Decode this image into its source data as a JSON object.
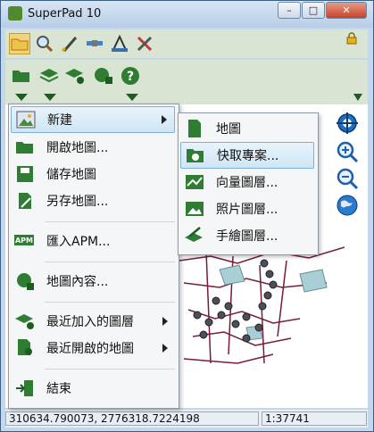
{
  "window": {
    "title": "SuperPad 10"
  },
  "window_buttons": {
    "minimize": "–",
    "maximize": "□",
    "close": "✕"
  },
  "toolbar1": {
    "items": [
      "folder-icon",
      "magnifier-icon",
      "pencil-icon",
      "satellite-icon",
      "survey-icon",
      "tools-icon"
    ],
    "selected": "folder-icon"
  },
  "toolbar2": {
    "items": [
      "open-folder-dropdown",
      "layers-add-dropdown",
      "layers-settings-dropdown",
      "globe-lock-dropdown",
      "help-dropdown"
    ]
  },
  "main_menu": {
    "items": [
      {
        "label": "新建",
        "icon": "new-image-icon",
        "submenu": true,
        "highlighted": true
      },
      {
        "label": "開啟地圖...",
        "icon": "open-folder-icon"
      },
      {
        "label": "儲存地圖",
        "icon": "save-icon"
      },
      {
        "label": "另存地圖...",
        "icon": "save-as-icon"
      },
      {
        "label": "匯入APM...",
        "icon": "apm-import-icon"
      },
      {
        "label": "地圖內容...",
        "icon": "map-properties-icon"
      },
      {
        "label": "最近加入的圖層",
        "icon": "recent-layers-icon",
        "submenu": true
      },
      {
        "label": "最近開啟的地圖",
        "icon": "recent-maps-icon",
        "submenu": true
      },
      {
        "label": "結束",
        "icon": "exit-icon"
      }
    ]
  },
  "submenu": {
    "items": [
      {
        "label": "地圖",
        "icon": "map-document-icon"
      },
      {
        "label": "快取專案...",
        "icon": "cache-project-icon",
        "highlighted": true
      },
      {
        "label": "向量圖層...",
        "icon": "vector-layer-icon"
      },
      {
        "label": "照片圖層...",
        "icon": "photo-layer-icon"
      },
      {
        "label": "手繪圖層...",
        "icon": "sketch-layer-icon"
      }
    ]
  },
  "map_tools": [
    "pan-crosshair-icon",
    "zoom-in-icon",
    "zoom-out-icon",
    "globe-icon"
  ],
  "status": {
    "coordinates": "310634.790073, 2776318.7224198",
    "scale": "1:37741"
  }
}
